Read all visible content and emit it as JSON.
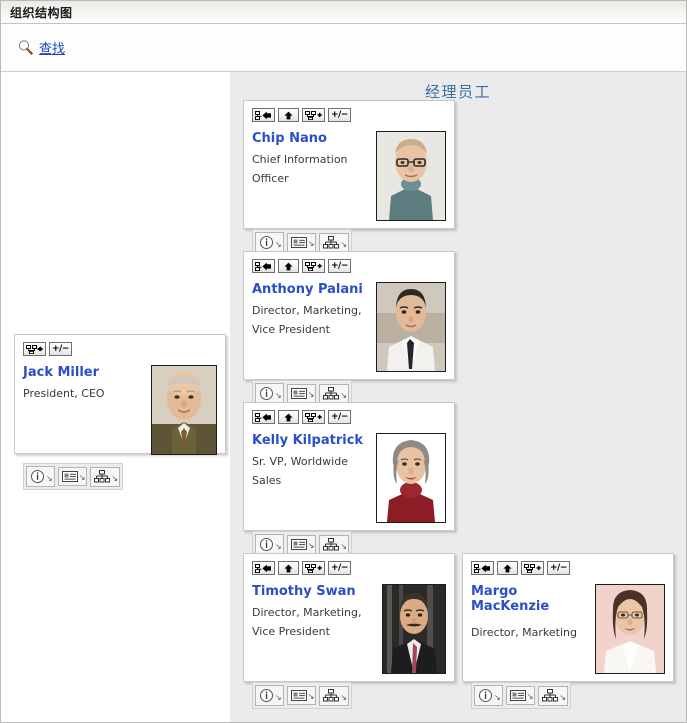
{
  "window": {
    "title": "组织结构图"
  },
  "toolbar": {
    "search_label": "查找",
    "search_icon": "magnifier-icon"
  },
  "panes": {
    "left": {
      "heading": ""
    },
    "right": {
      "heading": "经理员工"
    }
  },
  "node_tools": {
    "top": [
      {
        "name": "move-to-parent-tree-button",
        "icon": "tree-left-arrow-icon",
        "label": ""
      },
      {
        "name": "go-up-button",
        "icon": "up-arrow-icon",
        "label": ""
      },
      {
        "name": "expand-subtree-button",
        "icon": "org-chart-plus-icon",
        "label": ""
      },
      {
        "name": "toggle-expand-button",
        "icon": "plus-minus-icon",
        "label": "+/−"
      }
    ],
    "top_root": [
      {
        "name": "expand-subtree-button",
        "icon": "org-chart-plus-icon",
        "label": ""
      },
      {
        "name": "toggle-expand-button",
        "icon": "plus-minus-icon",
        "label": "+/−"
      }
    ],
    "bottom": [
      {
        "name": "details-button",
        "icon": "info-circle-icon",
        "caret": "↘"
      },
      {
        "name": "contact-card-button",
        "icon": "card-icon",
        "caret": "↘"
      },
      {
        "name": "org-chart-button",
        "icon": "org-chart-icon",
        "caret": "↘"
      }
    ]
  },
  "nodes": {
    "root": {
      "name": "Jack Miller",
      "title": "President, CEO",
      "photo_alt": "jack-miller-portrait"
    },
    "employees": [
      {
        "name": "Chip Nano",
        "title_line1": "Chief Information",
        "title_line2": "Officer",
        "photo_alt": "chip-nano-portrait"
      },
      {
        "name": "Anthony Palani",
        "title_line1": "Director, Marketing,",
        "title_line2": "Vice President",
        "photo_alt": "anthony-palani-portrait"
      },
      {
        "name": "Kelly Kilpatrick",
        "title_line1": "Sr. VP, Worldwide",
        "title_line2": "Sales",
        "photo_alt": "kelly-kilpatrick-portrait"
      },
      {
        "name": "Timothy Swan",
        "title_line1": "Director, Marketing,",
        "title_line2": "Vice President",
        "photo_alt": "timothy-swan-portrait"
      },
      {
        "name_line1": "Margo",
        "name_line2": "MacKenzie",
        "title_line1": "Director, Marketing",
        "title_line2": "",
        "photo_alt": "margo-mackenzie-portrait"
      }
    ]
  },
  "colors": {
    "name_link": "#2a4fc8",
    "heading": "#3b6ea5",
    "search_link": "#1c48c4",
    "pane_right_bg": "#ebebeb",
    "card_bg": "#ffffff"
  }
}
